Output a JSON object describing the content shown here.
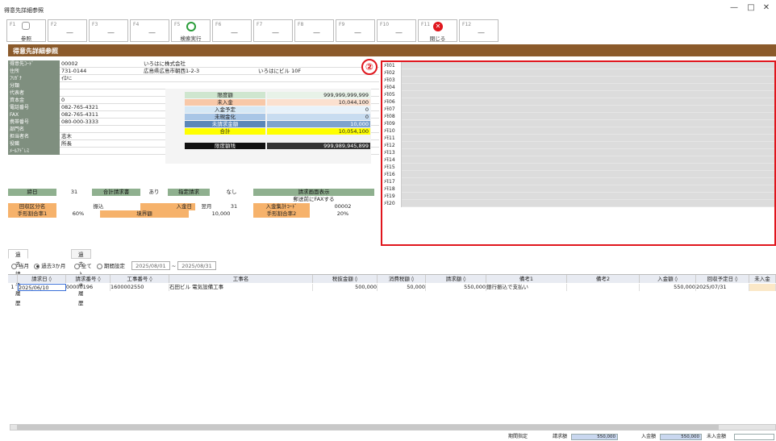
{
  "window": {
    "title": "得意先詳細参照",
    "minimize": "—",
    "maximize": "□",
    "close": "✕"
  },
  "fkeys": [
    {
      "key": "F1",
      "label": "参照"
    },
    {
      "key": "F2",
      "label": ""
    },
    {
      "key": "F3",
      "label": ""
    },
    {
      "key": "F4",
      "label": ""
    },
    {
      "key": "F5",
      "label": "検索実行"
    },
    {
      "key": "F6",
      "label": ""
    },
    {
      "key": "F7",
      "label": ""
    },
    {
      "key": "F8",
      "label": ""
    },
    {
      "key": "F9",
      "label": ""
    },
    {
      "key": "F10",
      "label": ""
    },
    {
      "key": "F11",
      "label": "閉じる"
    },
    {
      "key": "F12",
      "label": ""
    }
  ],
  "panel_title": "得意先詳細参照",
  "info": {
    "code_label": "得意先ｺｰﾄﾞ",
    "code": "00002",
    "name": "いろはに株式会社",
    "addr_label": "住所",
    "zip": "731-0144",
    "addr1": "広島県広島市朝西1-2-3",
    "addr2": "いろはにビル 10F",
    "kana_label": "ﾌﾘｶﾞﾅ",
    "kana": "ｲﾛﾊﾆ",
    "class_label": "分類",
    "rep_label": "代表者",
    "capital_label": "資本金",
    "capital": "0",
    "tel_label": "電話番号",
    "tel": "082-765-4321",
    "fax_label": "FAX",
    "fax": "082-765-4311",
    "mobile_label": "携帯番号",
    "mobile": "080-000-3333",
    "dept_label": "部門名",
    "person_label": "担当者名",
    "person": "志木",
    "title_label": "役職",
    "title": "所長",
    "mail_label": "ﾒｰﾙｱﾄﾞﾚｽ"
  },
  "summary": [
    {
      "label": "限度額",
      "value": "999,999,999,999"
    },
    {
      "label": "未入金",
      "value": "10,044,100"
    },
    {
      "label": "入金予定",
      "value": "0"
    },
    {
      "label": "未現金化",
      "value": "0"
    },
    {
      "label": "未請求金額",
      "value": "10,000"
    },
    {
      "label": "合計",
      "value": "10,054,100"
    },
    {
      "label": "",
      "value": ""
    },
    {
      "label": "限度額残",
      "value": "999,989,945,899"
    }
  ],
  "memo_labels": [
    "ﾒﾓ01",
    "ﾒﾓ02",
    "ﾒﾓ03",
    "ﾒﾓ04",
    "ﾒﾓ05",
    "ﾒﾓ06",
    "ﾒﾓ07",
    "ﾒﾓ08",
    "ﾒﾓ09",
    "ﾒﾓ10",
    "ﾒﾓ11",
    "ﾒﾓ12",
    "ﾒﾓ13",
    "ﾒﾓ14",
    "ﾒﾓ15",
    "ﾒﾓ16",
    "ﾒﾓ17",
    "ﾒﾓ18",
    "ﾒﾓ19",
    "ﾒﾓ20"
  ],
  "annotation": "②",
  "billing": {
    "closing_label": "締日",
    "closing": "31",
    "total_inv_label": "合計請求書",
    "total_inv": "あり",
    "designated_label": "指定請求",
    "designated": "なし",
    "screen_label": "請求画面表示",
    "fax_before": "郵送前にFAXする",
    "collect_label": "回収区分名",
    "collect": "振込",
    "payday_label": "入金日",
    "payday_month": "翌月",
    "payday": "31",
    "pay_agg_label": "入金集計ｺｰﾄﾞ",
    "pay_agg": "00002",
    "bill_rate_label": "手形割合率1",
    "bill_rate": "60%",
    "border_label": "境界額",
    "border": "10,000",
    "bill_rate2_label": "手形割合率2",
    "bill_rate2": "20%"
  },
  "tabs": [
    "過去請求履歴",
    "過去入金履歴"
  ],
  "filters": {
    "opt1": "当月",
    "opt2": "過去3か月",
    "opt3": "全て",
    "opt4": "期間設定",
    "date_from": "2025/08/01",
    "sep": "~",
    "date_to": "2025/08/31"
  },
  "table": {
    "headers": [
      "",
      "請求日 ◊",
      "請求番号 ◊",
      "工事番号 ◊",
      "工事名",
      "税抜金額 ◊",
      "消費税額 ◊",
      "請求額 ◊",
      "備考1",
      "備考2",
      "入金額 ◊",
      "回収予定日 ◊",
      "未入金"
    ],
    "rows": [
      [
        "1",
        "2025/06/10",
        "00000196",
        "1600002550",
        "石田ビル 電気設備工事",
        "500,000",
        "50,000",
        "550,000",
        "銀行振込で支払い",
        "",
        "550,000",
        "2025/07/31",
        ""
      ]
    ]
  },
  "footer": {
    "period_label": "期間指定",
    "bill_label": "請求額",
    "bill": "550,000",
    "pay_label": "入金額",
    "pay": "550,000",
    "unpaid_label": "未入金額"
  },
  "colors": {
    "panel_header": "#8B5A2B",
    "label_bg": "#7f8f7f",
    "accent_red": "#e0161d",
    "total_yellow": "#ffff00"
  }
}
